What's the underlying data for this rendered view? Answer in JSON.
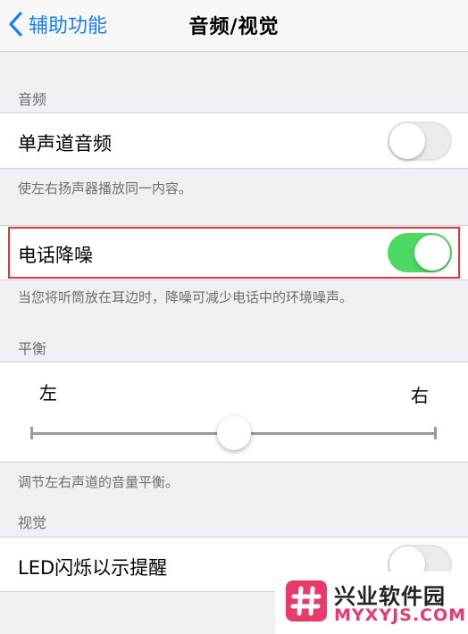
{
  "navbar": {
    "back_label": "辅助功能",
    "title": "音频/视觉"
  },
  "audio_section": {
    "header": "音频",
    "mono_audio": {
      "label": "单声道音频",
      "enabled": false
    },
    "mono_note": "使左右扬声器播放同一内容。",
    "phone_noise": {
      "label": "电话降噪",
      "enabled": true
    },
    "phone_note": "当您将听筒放在耳边时，降噪可减少电话中的环境噪声。"
  },
  "balance_section": {
    "header": "平衡",
    "left_label": "左",
    "right_label": "右",
    "balance_value": 0.5,
    "note": "调节左右声道的音量平衡。"
  },
  "visual_section": {
    "header": "视觉",
    "led_flash": {
      "label": "LED闪烁以示提醒",
      "enabled": false
    }
  },
  "watermark": {
    "name": "兴业软件园",
    "url": "MYXYJS.COM"
  },
  "colors": {
    "accent": "#147efb",
    "toggle_on": "#4cd964",
    "highlight": "#e8323c",
    "watermark": "#e83a6c"
  }
}
